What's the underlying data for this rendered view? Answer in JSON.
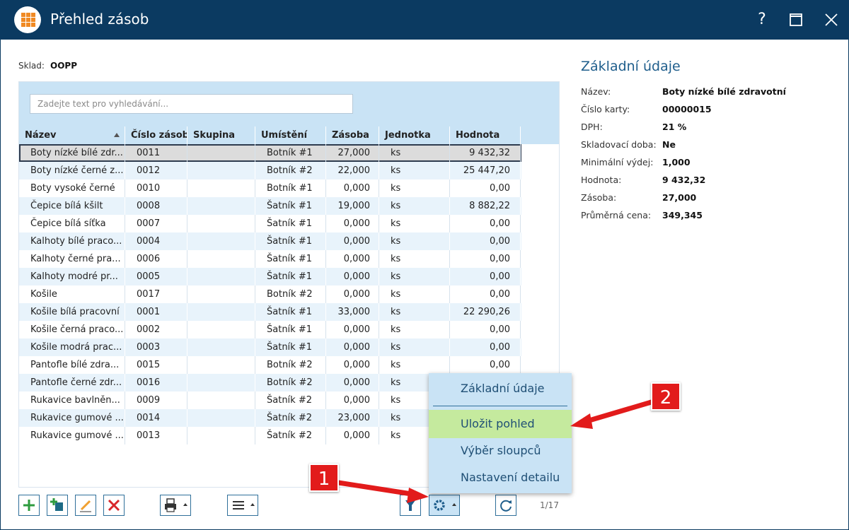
{
  "window": {
    "title": "Přehled zásob",
    "help_label": "?",
    "maximize_label": "☐",
    "close_label": "✕"
  },
  "sklad": {
    "label": "Sklad:",
    "value": "OOPP"
  },
  "search": {
    "placeholder": "Zadejte text pro vyhledávání..."
  },
  "columns": [
    "Název",
    "Číslo zásoby",
    "Skupina",
    "Umístění",
    "Zásoba",
    "Jednotka",
    "Hodnota"
  ],
  "rows": [
    {
      "name": "Boty nízké bílé zdr...",
      "num": "0011",
      "group": "",
      "loc": "Botník #1",
      "qty": "27,000",
      "unit": "ks",
      "value": "9 432,32"
    },
    {
      "name": "Boty nízké černé z...",
      "num": "0012",
      "group": "",
      "loc": "Botník #2",
      "qty": "22,000",
      "unit": "ks",
      "value": "25 447,20"
    },
    {
      "name": "Boty vysoké černé",
      "num": "0010",
      "group": "",
      "loc": "Botník #1",
      "qty": "0,000",
      "unit": "ks",
      "value": "0,00"
    },
    {
      "name": "Čepice bílá kšilt",
      "num": "0008",
      "group": "",
      "loc": "Šatník #1",
      "qty": "19,000",
      "unit": "ks",
      "value": "8 882,22"
    },
    {
      "name": "Čepice bílá síťka",
      "num": "0007",
      "group": "",
      "loc": "Šatník #1",
      "qty": "0,000",
      "unit": "ks",
      "value": "0,00"
    },
    {
      "name": "Kalhoty bílé praco...",
      "num": "0004",
      "group": "",
      "loc": "Šatník #1",
      "qty": "0,000",
      "unit": "ks",
      "value": "0,00"
    },
    {
      "name": "Kalhoty černé pra...",
      "num": "0006",
      "group": "",
      "loc": "Šatník #1",
      "qty": "0,000",
      "unit": "ks",
      "value": "0,00"
    },
    {
      "name": "Kalhoty modré pr...",
      "num": "0005",
      "group": "",
      "loc": "Šatník #1",
      "qty": "0,000",
      "unit": "ks",
      "value": "0,00"
    },
    {
      "name": "Košile",
      "num": "0017",
      "group": "",
      "loc": "Botník #2",
      "qty": "0,000",
      "unit": "ks",
      "value": "0,00"
    },
    {
      "name": "Košile bílá pracovní",
      "num": "0001",
      "group": "",
      "loc": "Šatník #1",
      "qty": "33,000",
      "unit": "ks",
      "value": "22 290,26"
    },
    {
      "name": "Košile černá praco...",
      "num": "0002",
      "group": "",
      "loc": "Šatník #1",
      "qty": "0,000",
      "unit": "ks",
      "value": "0,00"
    },
    {
      "name": "Košile modrá prac...",
      "num": "0003",
      "group": "",
      "loc": "Šatník #1",
      "qty": "0,000",
      "unit": "ks",
      "value": "0,00"
    },
    {
      "name": "Pantofle bílé zdra...",
      "num": "0015",
      "group": "",
      "loc": "Botník #2",
      "qty": "0,000",
      "unit": "ks",
      "value": "0,00"
    },
    {
      "name": "Pantofle černé zdr...",
      "num": "0016",
      "group": "",
      "loc": "Botník #2",
      "qty": "0,000",
      "unit": "ks",
      "value": ""
    },
    {
      "name": "Rukavice bavlněn...",
      "num": "0009",
      "group": "",
      "loc": "Šatník #2",
      "qty": "0,000",
      "unit": "ks",
      "value": ""
    },
    {
      "name": "Rukavice gumové ...",
      "num": "0014",
      "group": "",
      "loc": "Šatník #2",
      "qty": "23,000",
      "unit": "ks",
      "value": ""
    },
    {
      "name": "Rukavice gumové ...",
      "num": "0013",
      "group": "",
      "loc": "Šatník #2",
      "qty": "0,000",
      "unit": "ks",
      "value": ""
    }
  ],
  "pager": "1/17",
  "detail": {
    "title": "Základní údaje",
    "fields": [
      {
        "label": "Název:",
        "value": "Boty nízké bílé zdravotní"
      },
      {
        "label": "Číslo karty:",
        "value": "00000015"
      },
      {
        "label": "DPH:",
        "value": "21 %"
      },
      {
        "label": "Skladovací doba:",
        "value": "Ne"
      },
      {
        "label": "Minimální výdej:",
        "value": "1,000"
      },
      {
        "label": "Hodnota:",
        "value": "9 432,32"
      },
      {
        "label": "Zásoba:",
        "value": "27,000"
      },
      {
        "label": "Průměrná cena:",
        "value": "349,345"
      }
    ]
  },
  "menu": {
    "items": [
      "Základní údaje",
      "Uložit pohled",
      "Výběr sloupců",
      "Nastavení detailu"
    ]
  },
  "callouts": [
    "1",
    "2"
  ],
  "colors": {
    "titlebar": "#0b3a61",
    "accent": "#1f5e8c",
    "header": "#c9e3f5",
    "highlight": "#c5ea9e",
    "callout": "#e21b1b"
  }
}
